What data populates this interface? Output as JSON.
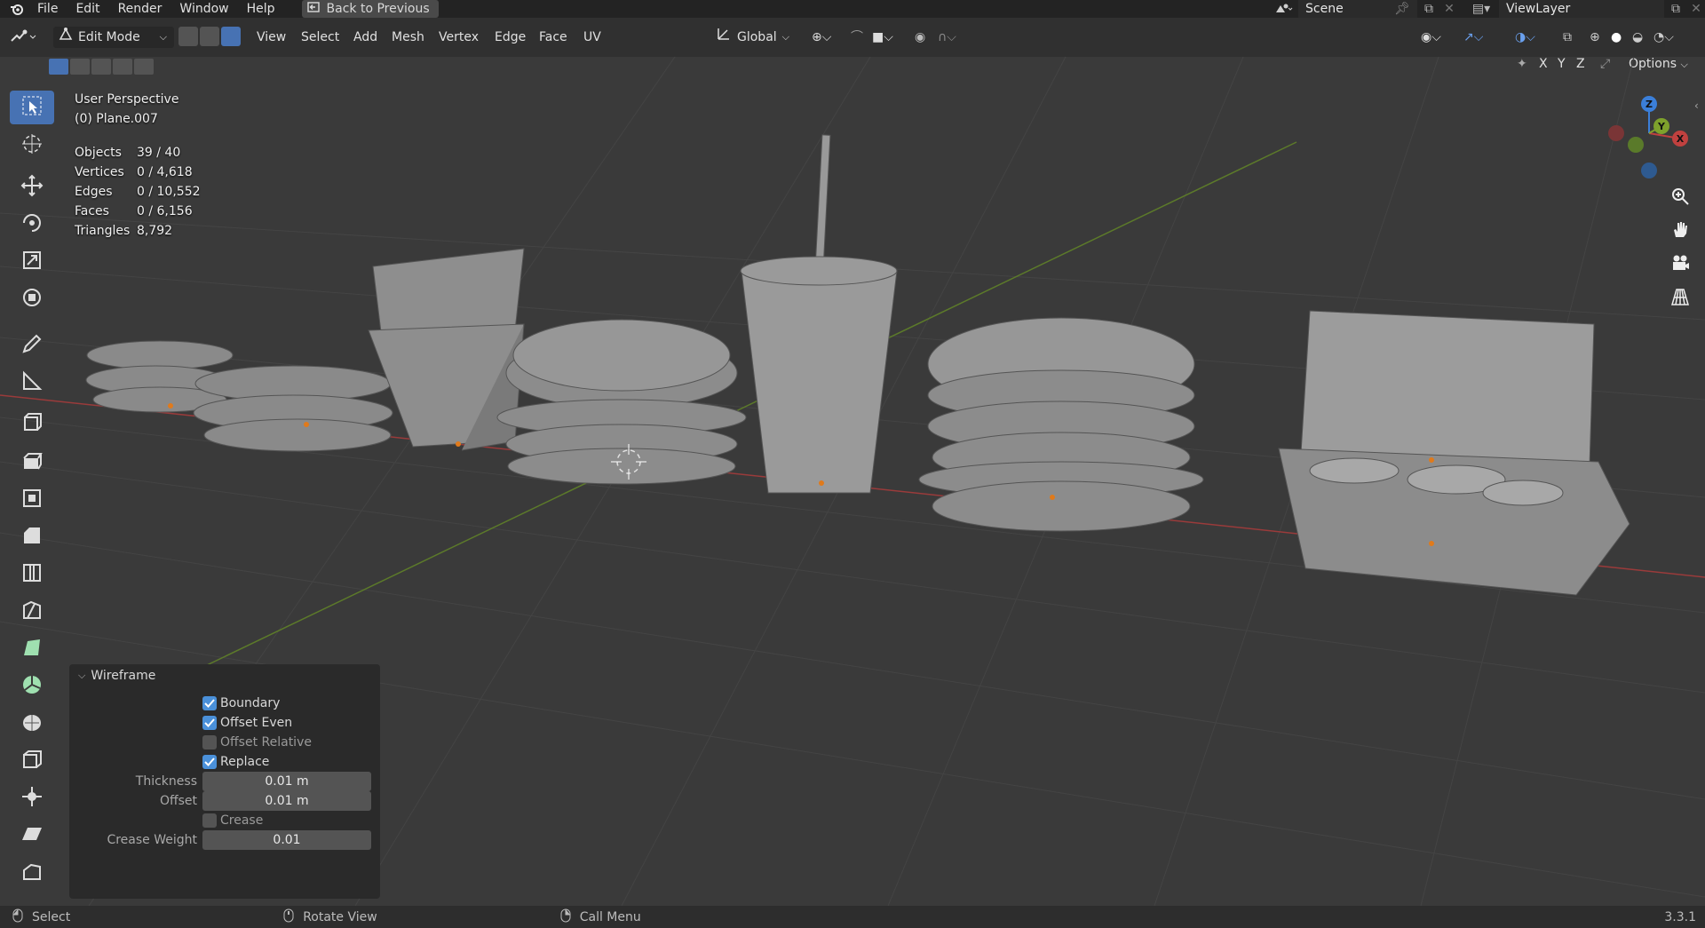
{
  "topbar": {
    "menus": [
      "File",
      "Edit",
      "Render",
      "Window",
      "Help"
    ],
    "back_button": "Back to Previous",
    "scene_name": "Scene",
    "view_layer": "ViewLayer"
  },
  "header": {
    "mode": "Edit Mode",
    "menus": [
      "View",
      "Select",
      "Add",
      "Mesh",
      "Vertex",
      "Edge",
      "Face",
      "UV"
    ],
    "transform_orientation": "Global",
    "axis_labels": [
      "X",
      "Y",
      "Z"
    ],
    "options_label": "Options"
  },
  "overlay": {
    "perspective": "User Perspective",
    "object_name": "(0) Plane.007",
    "stats": [
      {
        "label": "Objects",
        "value": "39 / 40"
      },
      {
        "label": "Vertices",
        "value": "0 / 4,618"
      },
      {
        "label": "Edges",
        "value": "0 / 10,552"
      },
      {
        "label": "Faces",
        "value": "0 / 6,156"
      },
      {
        "label": "Triangles",
        "value": "8,792"
      }
    ]
  },
  "gizmo": {
    "x": "X",
    "y": "Y",
    "z": "Z"
  },
  "wireframe_panel": {
    "title": "Wireframe",
    "boundary": {
      "label": "Boundary",
      "checked": true
    },
    "offset_even": {
      "label": "Offset Even",
      "checked": true
    },
    "offset_relative": {
      "label": "Offset Relative",
      "checked": false
    },
    "replace": {
      "label": "Replace",
      "checked": true
    },
    "thickness": {
      "label": "Thickness",
      "value": "0.01 m"
    },
    "offset": {
      "label": "Offset",
      "value": "0.01 m"
    },
    "crease": {
      "label": "Crease",
      "checked": false
    },
    "crease_weight": {
      "label": "Crease Weight",
      "value": "0.01"
    }
  },
  "statusbar": {
    "select": "Select",
    "rotate": "Rotate View",
    "call_menu": "Call Menu",
    "version": "3.3.1"
  },
  "colors": {
    "accent": "#4772b3",
    "checkbox_on": "#4a90d9",
    "axis_x": "#c0413f",
    "axis_y": "#7ea12c",
    "axis_z": "#3b7fd9"
  }
}
